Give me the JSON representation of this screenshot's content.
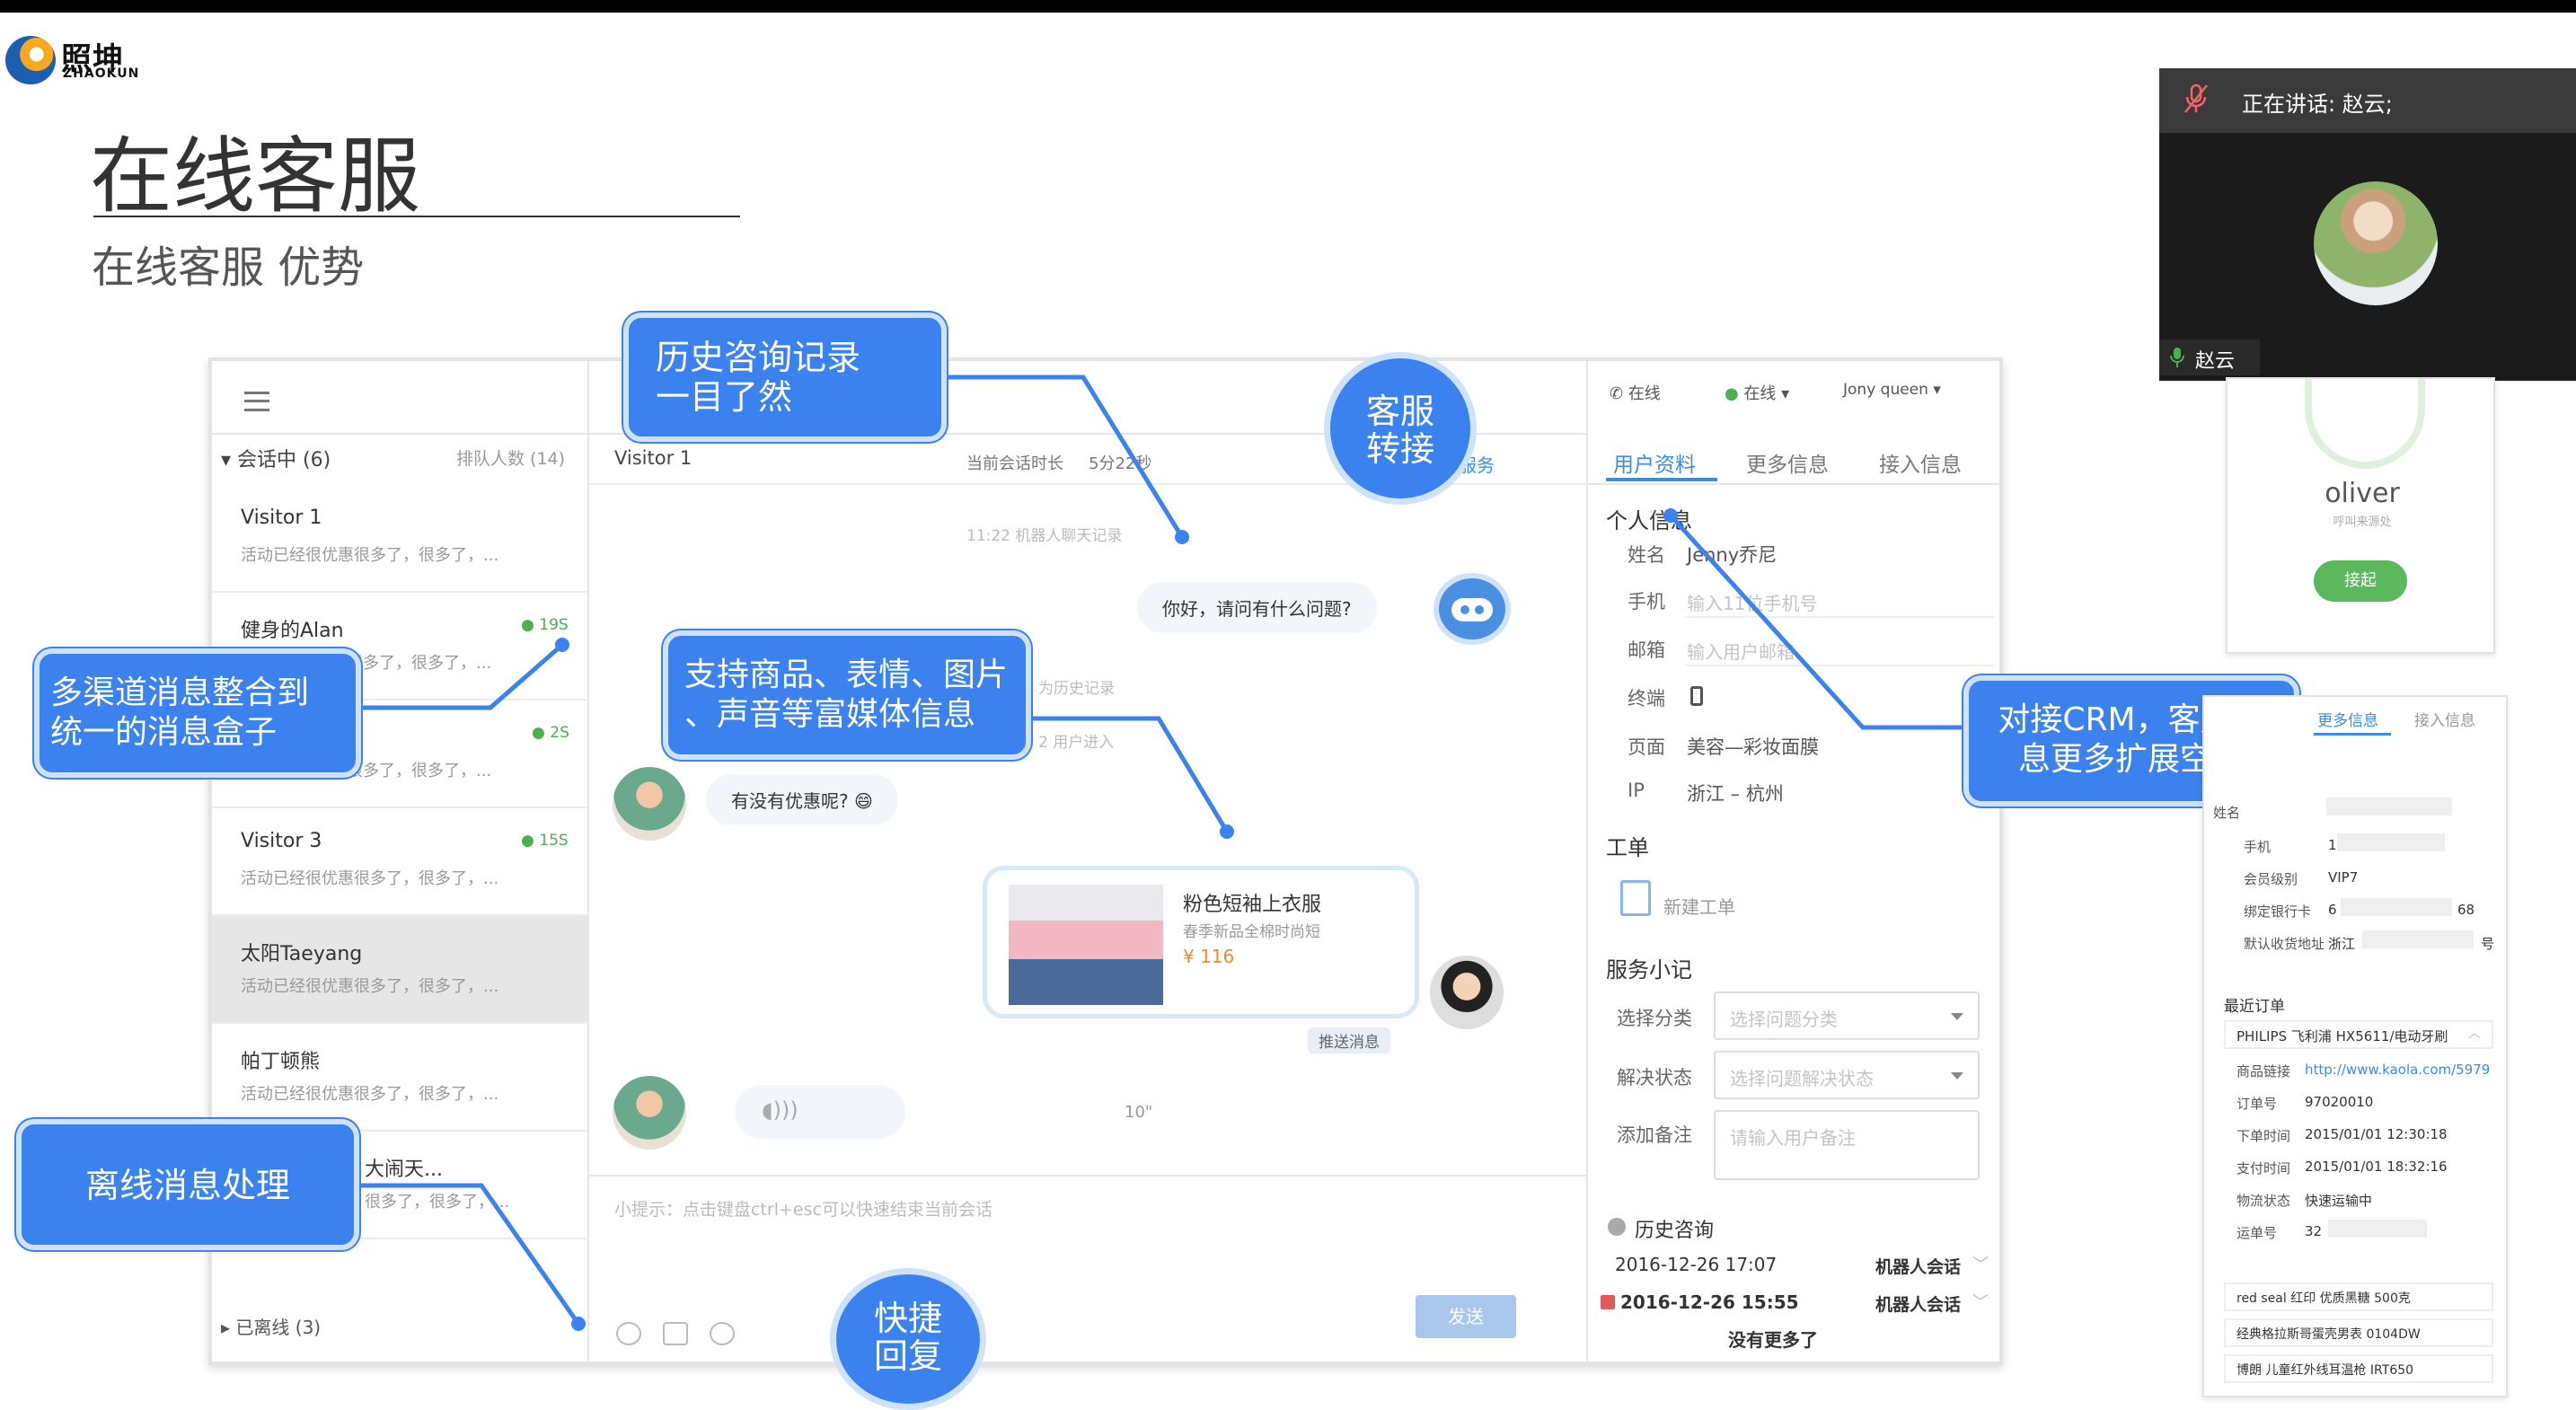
{
  "logo": {
    "cn": "照坤",
    "en": "ZHAOKUN"
  },
  "slide": {
    "title": "在线客服",
    "subtitle": "在线客服 优势"
  },
  "left_panel": {
    "header": "会话中 (6)",
    "queue": "排队人数 (14)",
    "items": [
      {
        "name": "Visitor 1",
        "msg": "活动已经很优惠很多了，很多了，...",
        "badge": ""
      },
      {
        "name": "健身的Alan",
        "msg": "很多了，很多了，...",
        "badge": "19S"
      },
      {
        "name": "",
        "msg": "很多了，很多了，...",
        "badge": "2S"
      },
      {
        "name": "Visitor 3",
        "msg": "活动已经很优惠很多了，很多了，...",
        "badge": "15S"
      },
      {
        "name": "太阳Taeyang",
        "msg": "活动已经很优惠很多了，很多了，...",
        "badge": ""
      },
      {
        "name": "帕丁顿熊",
        "msg": "活动已经很优惠很多了，很多了，...",
        "badge": ""
      },
      {
        "name": "大闹天...",
        "msg": "很多了，很多了，...",
        "badge": ""
      }
    ],
    "offline": "已离线 (3)"
  },
  "chat": {
    "visitor": "Visitor 1",
    "duration_label": "当前会话时长",
    "duration_value": "5分22秒",
    "transfer_fragment": "服务",
    "sys1": "11:22  机器人聊天记录",
    "bot_msg": "你好，请问有什么问题?",
    "sys2": "为历史记录",
    "sys3": "2  用户进入",
    "user_msg": "有没有优惠呢? 😄",
    "product": {
      "name": "粉色短袖上衣服",
      "desc": "春季新品全棉时尚短",
      "price": "¥ 116"
    },
    "push_tag": "推送消息",
    "voice_seconds": "10\"",
    "hint": "小提示：点击键盘ctrl+esc可以快速结束当前会话",
    "send": "发送"
  },
  "right_panel": {
    "status_phone": "在线",
    "status_chat": "在线 ▾",
    "agent": "Jony queen ▾",
    "tabs": [
      "用户资料",
      "更多信息",
      "接入信息"
    ],
    "personal_title": "个人信息",
    "fields": [
      {
        "label": "姓名",
        "value": "Jenny乔尼"
      },
      {
        "label": "手机",
        "placeholder": "输入11位手机号"
      },
      {
        "label": "邮箱",
        "placeholder": "输入用户邮箱"
      },
      {
        "label": "终端",
        "value": ""
      },
      {
        "label": "页面",
        "value": "美容—彩妆面膜"
      },
      {
        "label": "IP",
        "value": "浙江 – 杭州"
      }
    ],
    "ticket_title": "工单",
    "new_ticket": "新建工单",
    "service_title": "服务小记",
    "category_label": "选择分类",
    "category_ph": "选择问题分类",
    "status_label": "解决状态",
    "status_ph": "选择问题解决状态",
    "note_label": "添加备注",
    "note_ph": "请输入用户备注",
    "history_title": "历史咨询",
    "history": [
      {
        "date": "2016-12-26 17:07",
        "type": "机器人会话"
      },
      {
        "date": "2016-12-26 15:55",
        "type": "机器人会话"
      }
    ],
    "no_more": "没有更多了"
  },
  "callouts": {
    "history": "历史咨询记录\n一目了然",
    "transfer": "客服\n转接",
    "multichannel": "多渠道消息整合到\n统一的消息盒子",
    "media": "支持商品、表情、图片\n、声音等富媒体信息",
    "crm": "对接CRM，客户信\n息更多扩展空间",
    "offline": "离线消息处理",
    "quick": "快捷\n回复"
  },
  "video": {
    "speaking": "正在讲话: 赵云;",
    "name": "赵云"
  },
  "card1": {
    "name": "oliver",
    "sub": "呼叫来源处",
    "accept": "接起"
  },
  "card2": {
    "tabs": [
      "更多信息",
      "接入信息"
    ],
    "rows": [
      {
        "label": "姓名",
        "value": ""
      },
      {
        "label": "手机",
        "value": "1"
      },
      {
        "label": "会员级别",
        "value": "VIP7"
      },
      {
        "label": "绑定银行卡",
        "value": "6",
        "tail": "68"
      },
      {
        "label": "默认收货地址",
        "value": "浙江",
        "tail": "号"
      }
    ],
    "orders_title": "最近订单",
    "order_product": "PHILIPS 飞利浦 HX5611/电动牙刷",
    "order_rows": [
      {
        "label": "商品链接",
        "value": "http://www.kaola.com/5979"
      },
      {
        "label": "订单号",
        "value": "97020010"
      },
      {
        "label": "下单时间",
        "value": "2015/01/01  12:30:18"
      },
      {
        "label": "支付时间",
        "value": "2015/01/01  18:32:16"
      },
      {
        "label": "物流状态",
        "value": "快速运输中"
      },
      {
        "label": "运单号",
        "value": "32"
      }
    ],
    "other_orders": [
      "red seal 红印 优质黑糖 500克",
      "经典格拉斯哥蛋壳男表 0104DW",
      "博朗 儿童红外线耳温枪 IRT650"
    ]
  }
}
